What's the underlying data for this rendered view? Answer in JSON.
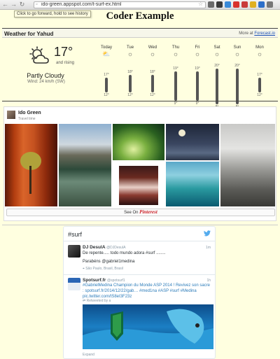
{
  "browser": {
    "url": "ido-green.appspot.com/t-surf-ex.html",
    "tooltip": "Click to go forward, hold to see history"
  },
  "page": {
    "title": "Coder Example"
  },
  "weather": {
    "header": "Weather for Yahud",
    "more_prefix": "More at",
    "more_link": "Forecast.io",
    "temperature": "17°",
    "trend": "and rising",
    "condition": "Partly Cloudy",
    "wind": "Wind: 24 km/h (SW)",
    "days": [
      {
        "name": "Today",
        "icon": "partly-cloudy-icon",
        "hi": "17°",
        "lo": "12°"
      },
      {
        "name": "Tue",
        "icon": "sun-icon",
        "hi": "18°",
        "lo": "12°"
      },
      {
        "name": "Wed",
        "icon": "sun-icon",
        "hi": "18°",
        "lo": "12°"
      },
      {
        "name": "Thu",
        "icon": "sun-icon",
        "hi": "19°",
        "lo": "9°"
      },
      {
        "name": "Fri",
        "icon": "sun-icon",
        "hi": "19°",
        "lo": "9°"
      },
      {
        "name": "Sat",
        "icon": "sun-icon",
        "hi": "20°",
        "lo": "8°"
      },
      {
        "name": "Sun",
        "icon": "sun-icon",
        "hi": "20°",
        "lo": "8°"
      },
      {
        "name": "Mon",
        "icon": "sun-icon",
        "hi": "17°",
        "lo": "12°"
      }
    ]
  },
  "pinterest": {
    "user": "Ido Green",
    "board": "Travel time",
    "see_on": "See On",
    "brand": "Pinterest"
  },
  "twitter": {
    "title": "#surf",
    "tweets": [
      {
        "name": "DJ DesulA",
        "handle": "@DJDesulA",
        "time": "1m",
        "text": "De repente..... todo mundo adora #surf ........",
        "line2": "Parabéns @gabriel1medina",
        "location": "São Paulo, Brasil, Brasil"
      },
      {
        "name": "Spotsurf.fr",
        "handle": "@spotsurf1",
        "time": "1h",
        "text": "#GabrielMedina Champion du Monde ASP 2014 ! Revivez son sacre : spotsurf.fr/2014/12/22/gab… #med1na #ASP #surf #Medina pic.twitter.com/tS8eI3F23z",
        "retweet": "Retweeted by a",
        "expand": "Expand"
      }
    ]
  }
}
